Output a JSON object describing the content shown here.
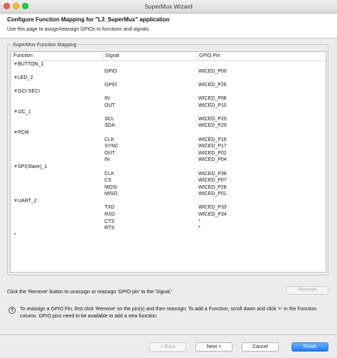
{
  "window": {
    "title": "SuperMux Wizard"
  },
  "header": {
    "title": "Configure Function Mapping for \"L3_SuperMux\" application",
    "description": "Use this page to assign/reassign GPIOs to functions and signals."
  },
  "group": {
    "label": "SuperMux Function Mapping"
  },
  "table": {
    "columns": [
      "Function",
      "Signal",
      "GPIO Pin"
    ],
    "rows": [
      {
        "function": "BUTTON_1",
        "signal": "",
        "gpio": ""
      },
      {
        "function": "",
        "signal": "GPIO",
        "gpio": "WICED_P00"
      },
      {
        "function": "LED_2",
        "signal": "",
        "gpio": ""
      },
      {
        "function": "",
        "signal": "GPIO",
        "gpio": "WICED_P26"
      },
      {
        "function": "GCI-SECI",
        "signal": "",
        "gpio": ""
      },
      {
        "function": "",
        "signal": "IN",
        "gpio": "WICED_P06"
      },
      {
        "function": "",
        "signal": "OUT",
        "gpio": "WICED_P10"
      },
      {
        "function": "I2C_1",
        "signal": "",
        "gpio": ""
      },
      {
        "function": "",
        "signal": "SCL",
        "gpio": "WICED_P25"
      },
      {
        "function": "",
        "signal": "SDA",
        "gpio": "WICED_P29"
      },
      {
        "function": "PCM",
        "signal": "",
        "gpio": ""
      },
      {
        "function": "",
        "signal": "CLK",
        "gpio": "WICED_P16"
      },
      {
        "function": "",
        "signal": "SYNC",
        "gpio": "WICED_P17"
      },
      {
        "function": "",
        "signal": "OUT",
        "gpio": "WICED_P02"
      },
      {
        "function": "",
        "signal": "IN",
        "gpio": "WICED_P04"
      },
      {
        "function": "SPI(Slave)_1",
        "signal": "",
        "gpio": ""
      },
      {
        "function": "",
        "signal": "CLK",
        "gpio": "WICED_P38"
      },
      {
        "function": "",
        "signal": "CS",
        "gpio": "WICED_P07"
      },
      {
        "function": "",
        "signal": "MOSI",
        "gpio": "WICED_P28"
      },
      {
        "function": "",
        "signal": "MISO",
        "gpio": "WICED_P01"
      },
      {
        "function": "UART_2",
        "signal": "",
        "gpio": ""
      },
      {
        "function": "",
        "signal": "TXD",
        "gpio": "WICED_P33"
      },
      {
        "function": "",
        "signal": "RXD",
        "gpio": "WICED_P34"
      },
      {
        "function": "",
        "signal": "CTS",
        "gpio": "*"
      },
      {
        "function": "",
        "signal": "RTS",
        "gpio": "*"
      },
      {
        "function": "*",
        "signal": "",
        "gpio": ""
      }
    ]
  },
  "info_text": "Click the 'Remove' button to unassign or reassign 'GPIO pin' to the 'Signal.'",
  "remove_label": "Remove",
  "help": {
    "icon": "?",
    "text": "To reassign a GPIO Pin, first click 'Remove' on the pin(s) and then reassign. To add a Function, scroll down and click '+' in the Function column. GPIO pins need to be available to add a new function."
  },
  "buttons": {
    "back": "< Back",
    "next": "Next >",
    "cancel": "Cancel",
    "finish": "Finish"
  },
  "colors": {
    "accent": "#1d7cf2",
    "close": "#fd5f57",
    "minimize": "#febc2e",
    "zoom": "#28c840"
  }
}
